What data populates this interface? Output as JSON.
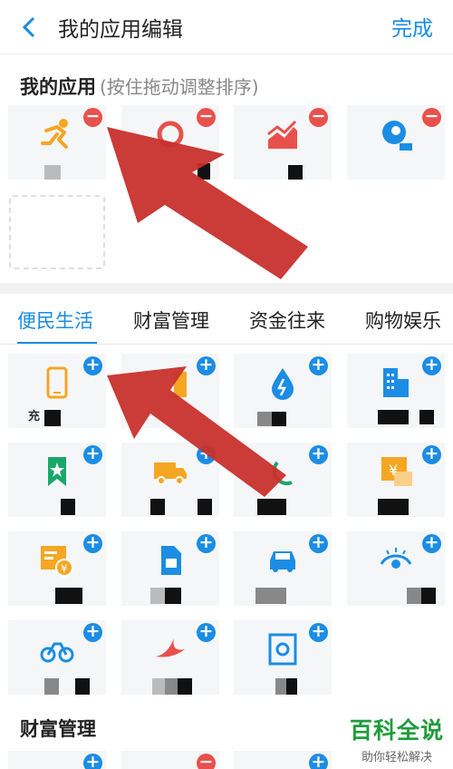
{
  "header": {
    "title": "我的应用编辑",
    "done_label": "完成"
  },
  "my_apps": {
    "title": "我的应用",
    "hint": "(按住拖动调整排序)"
  },
  "tabs": [
    {
      "label": "便民生活",
      "active": true
    },
    {
      "label": "财富管理",
      "active": false
    },
    {
      "label": "资金往来",
      "active": false
    },
    {
      "label": "购物娱乐",
      "active": false
    }
  ],
  "tile_labels": {
    "recharge_partial": "充"
  },
  "second_section": {
    "title": "财富管理"
  },
  "watermark": {
    "line1": "百科全说",
    "line2": "助你轻松解决"
  },
  "colors": {
    "accent": "#1a8be4",
    "remove_badge": "#e8514b",
    "add_badge": "#1c8de4",
    "icon_blue": "#1c8de4",
    "icon_orange": "#f5a623",
    "icon_red": "#e8514b",
    "icon_green": "#1aa86a",
    "arrow": "#c8302c"
  }
}
